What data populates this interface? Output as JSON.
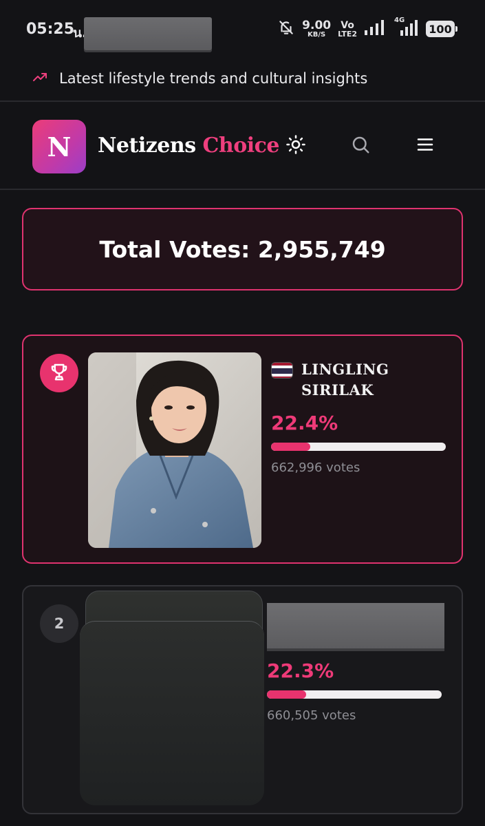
{
  "status_bar": {
    "time": "05:25",
    "speed_value": "9.00",
    "speed_unit": "KB/S",
    "volte_top": "Vo",
    "volte_bottom": "LTE2",
    "network_label": "4G",
    "battery": "100"
  },
  "top_banner": {
    "icon": "trending-up-icon",
    "text": "Latest lifestyle trends and cultural insights"
  },
  "header": {
    "logo_letter": "N",
    "brand_first": "Netizens",
    "brand_second": "Choice",
    "icons": [
      "sun-icon",
      "search-icon",
      "menu-icon"
    ]
  },
  "total": {
    "label": "Total Votes: 2,955,749"
  },
  "contestants": [
    {
      "rank_icon": "trophy-icon",
      "flag": "thailand-flag",
      "name_line1": "LINGLING",
      "name_line2": "SIRILAK",
      "percent_label": "22.4%",
      "percent_value": 22.4,
      "votes_label": "662,996 votes"
    },
    {
      "rank": "2",
      "percent_label": "22.3%",
      "percent_value": 22.3,
      "votes_label": "660,505 votes"
    }
  ],
  "colors": {
    "accent": "#e8336e",
    "background": "#131316",
    "card_border_active": "#e0336f"
  }
}
